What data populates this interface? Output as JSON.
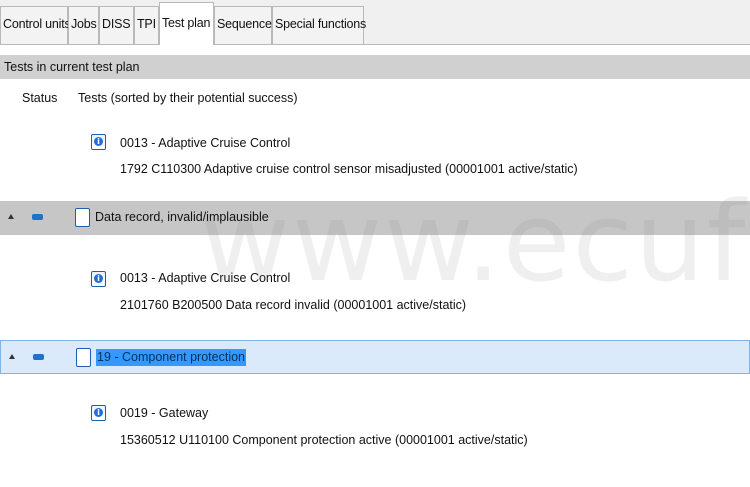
{
  "tabs": [
    "Control units",
    "Jobs",
    "DISS",
    "TPI",
    "Test plan",
    "Sequence",
    "Special functions"
  ],
  "active_tab": "Test plan",
  "section_title": "Tests in current test plan",
  "columns": {
    "status": "Status",
    "tests": "Tests (sorted by their potential success)"
  },
  "entries": [
    {
      "title": "0013 - Adaptive Cruise Control",
      "detail": "1792   C110300   Adaptive cruise control sensor misadjusted  (00001001   active/static)"
    },
    {
      "title": "0013 - Adaptive Cruise Control",
      "detail": "2101760   B200500   Data record invalid  (00001001   active/static)"
    },
    {
      "title": "0019 - Gateway",
      "detail": "15360512   U110100   Component protection active  (00001001   active/static)"
    }
  ],
  "groups": [
    {
      "label": "Data record, invalid/implausible"
    },
    {
      "label": "19 - Component protection"
    }
  ],
  "icons": {
    "info": "info-icon",
    "group": "document-icon",
    "expander": "expand-arrow-icon",
    "status": "status-indicator"
  },
  "watermark": "www.ecufix.ru",
  "colors": {
    "accent": "#1e72c8",
    "selection": "#3399ff",
    "selected_row": "#dbeafb",
    "group_row": "#c6c6c6"
  }
}
